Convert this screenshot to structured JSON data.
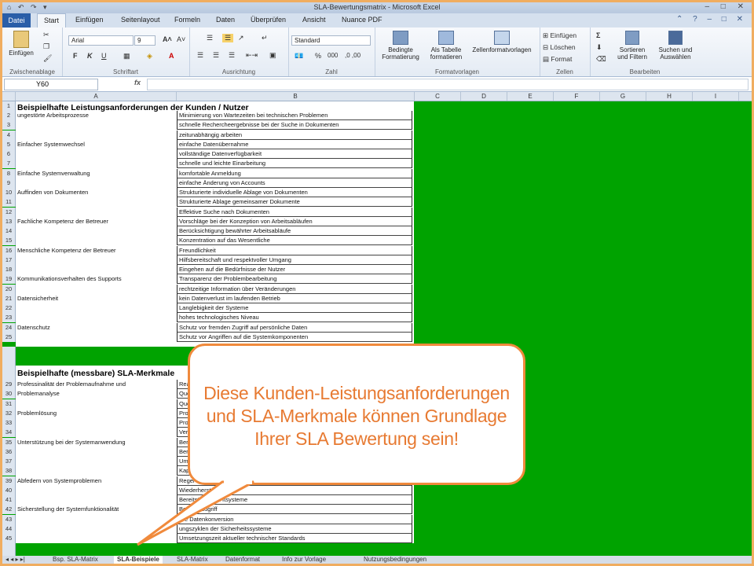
{
  "window": {
    "title": "SLA-Bewertungsmatrix - Microsoft Excel",
    "quick_access": "⌂ ↶ ↷ ▾",
    "controls": "– □ ✕",
    "help": "⌃ ? – □ ✕"
  },
  "ribbon_tabs": [
    "Datei",
    "Start",
    "Einfügen",
    "Seitenlayout",
    "Formeln",
    "Daten",
    "Überprüfen",
    "Ansicht",
    "Nuance PDF"
  ],
  "ribbon": {
    "clipboard": {
      "paste": "Einfügen",
      "label": "Zwischenablage"
    },
    "font": {
      "name": "Arial",
      "size": "9",
      "bold": "F",
      "italic": "K",
      "underline": "U",
      "label": "Schriftart"
    },
    "alignment": {
      "label": "Ausrichtung"
    },
    "number": {
      "format": "Standard",
      "percent": "%",
      "thousands": "000",
      "label": "Zahl"
    },
    "styles": {
      "conditional": "Bedingte Formatierung",
      "as_table": "Als Tabelle formatieren",
      "cell_styles": "Zellenformatvorlagen",
      "label": "Formatvorlagen"
    },
    "cells": {
      "insert": "Einfügen",
      "delete": "Löschen",
      "format": "Format",
      "label": "Zellen"
    },
    "editing": {
      "sum": "Σ",
      "sort": "Sortieren und Filtern",
      "find": "Suchen und Auswählen",
      "label": "Bearbeiten"
    }
  },
  "formula_bar": {
    "name_box": "Y60",
    "fx": "fx",
    "content": ""
  },
  "columns": [
    "A",
    "B",
    "C",
    "D",
    "E",
    "F",
    "G",
    "H",
    "I"
  ],
  "section1": {
    "title": "Beispielhafte Leistungsanforderungen der Kunden / Nutzer",
    "rows": [
      {
        "n": "2",
        "a": "ungestörte Arbeitsprozesse",
        "b": "Minimierung von Wartezeiten bei technischen Problemen"
      },
      {
        "n": "3",
        "a": "",
        "b": "schnelle Rechercheergebnisse bei der Suche in Dokumenten"
      },
      {
        "n": "4",
        "a": "",
        "b": "zeitunabhängig arbeiten"
      },
      {
        "n": "5",
        "a": "Einfacher Systemwechsel",
        "b": "einfache Datenübernahme"
      },
      {
        "n": "6",
        "a": "",
        "b": "vollständige Datenverfügbarkeit"
      },
      {
        "n": "7",
        "a": "",
        "b": "schnelle und leichte Einarbeitung"
      },
      {
        "n": "8",
        "a": "Einfache Systemverwaltung",
        "b": "komfortable Anmeldung"
      },
      {
        "n": "9",
        "a": "",
        "b": "einfache Änderung von Accounts"
      },
      {
        "n": "10",
        "a": "Auffinden von Dokumenten",
        "b": "Strukturierte individuelle Ablage von Dokumenten"
      },
      {
        "n": "11",
        "a": "",
        "b": "Strukturierte Ablage gemeinsamer Dokumente"
      },
      {
        "n": "12",
        "a": "",
        "b": "Effektive Suche nach Dokumenten"
      },
      {
        "n": "13",
        "a": "Fachliche Kompetenz der Betreuer",
        "b": "Vorschläge bei der Konzeption von Arbeitsabläufen"
      },
      {
        "n": "14",
        "a": "",
        "b": "Berücksichtigung bewährter Arbeitsabläufe"
      },
      {
        "n": "15",
        "a": "",
        "b": "Konzentration auf das Wesentliche"
      },
      {
        "n": "16",
        "a": "Menschliche Kompetenz der Betreuer",
        "b": "Freundlichkeit"
      },
      {
        "n": "17",
        "a": "",
        "b": "Hilfsbereitschaft und respektvoller Umgang"
      },
      {
        "n": "18",
        "a": "",
        "b": "Eingehen auf die Bedürfnisse der Nutzer"
      },
      {
        "n": "19",
        "a": "Kommunikationsverhalten des Supports",
        "b": "Transparenz der Problembearbeitung"
      },
      {
        "n": "20",
        "a": "",
        "b": "rechtzeitige Information über Veränderungen"
      },
      {
        "n": "21",
        "a": "Datensicherheit",
        "b": "kein Datenverlust im laufenden Betrieb"
      },
      {
        "n": "22",
        "a": "",
        "b": "Langlebigkeit der Systeme"
      },
      {
        "n": "23",
        "a": "",
        "b": "hohes technologisches Niveau"
      },
      {
        "n": "24",
        "a": "Datenschutz",
        "b": "Schutz vor fremden Zugriff auf persönliche Daten"
      },
      {
        "n": "25",
        "a": "",
        "b": "Schutz vor Angriffen auf die Systemkomponenten"
      }
    ]
  },
  "section2": {
    "title": "Beispielhafte (messbare) SLA-Merkmale",
    "rows": [
      {
        "n": "29",
        "a": "Professinalität der Problemaufnahme und",
        "b": "Rea"
      },
      {
        "n": "30",
        "a": "Problemanalyse",
        "b": "Quo"
      },
      {
        "n": "31",
        "a": "",
        "b": "Quo"
      },
      {
        "n": "32",
        "a": "Problemlösung",
        "b": "Prob"
      },
      {
        "n": "33",
        "a": "",
        "b": "Prob"
      },
      {
        "n": "34",
        "a": "",
        "b": "Ver"
      },
      {
        "n": "35",
        "a": "Unterstützung bei der Systemanwendung",
        "b": "Ber"
      },
      {
        "n": "36",
        "a": "",
        "b": "Bere"
      },
      {
        "n": "37",
        "a": "",
        "b": "Umf"
      },
      {
        "n": "38",
        "a": "",
        "b": "Kap"
      },
      {
        "n": "39",
        "a": "Abfedern von Systemproblemen",
        "b": "Regel"
      },
      {
        "n": "40",
        "a": "",
        "b": "Wiederherstellungsze"
      },
      {
        "n": "41",
        "a": "",
        "b": "Bereitstellungsz                          ıtsysteme"
      },
      {
        "n": "42",
        "a": "Sicherstellung der Systemfunktionalität",
        "b": "Bereitst                    Zugriff"
      },
      {
        "n": "43",
        "a": "",
        "b": "We                Datenkonversion"
      },
      {
        "n": "44",
        "a": "",
        "b": "          ungszyklen der Sicherheitssysteme"
      },
      {
        "n": "45",
        "a": "",
        "b": "Umsetzungszeit aktueller technischer Standards"
      }
    ]
  },
  "callout": {
    "lines": [
      "Diese Kunden-Leistungsanforderungen",
      "und SLA-Merkmale können Grundlage",
      "Ihrer SLA Bewertung sein!"
    ]
  },
  "sheet_tabs": [
    "Bsp. SLA-Matrix",
    "SLA-Beispiele",
    "SLA-Matrix",
    "Datenformat",
    "Info zur Vorlage",
    "Nutzungsbedingungen"
  ],
  "sheet_nav": "◂ ◂ ▸ ▸|"
}
